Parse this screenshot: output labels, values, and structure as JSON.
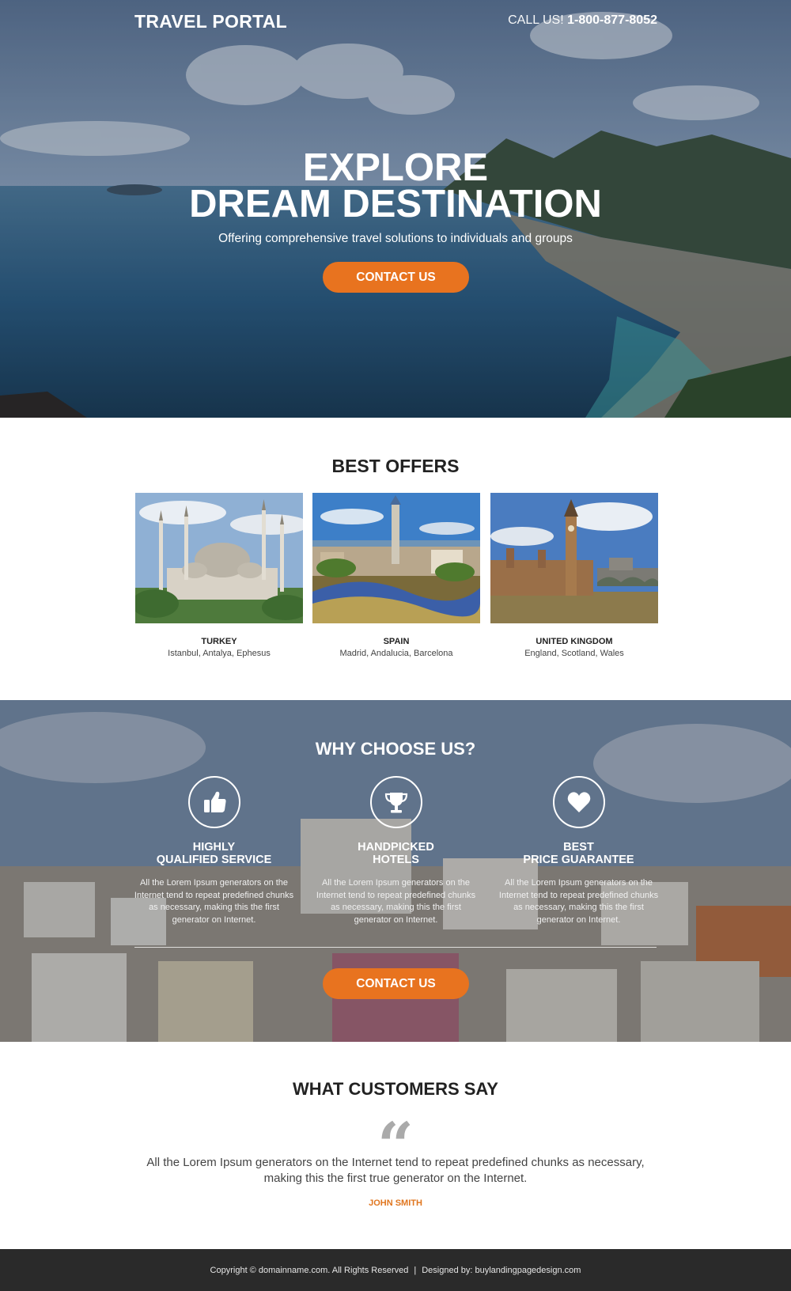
{
  "header": {
    "brand": "TRAVEL PORTAL",
    "call_label": "CALL US!",
    "phone": "1-800-877-8052"
  },
  "hero": {
    "title_line1": "EXPLORE",
    "title_line2": "DREAM DESTINATION",
    "subtitle": "Offering comprehensive travel solutions to individuals and groups",
    "cta_label": "CONTACT US"
  },
  "offers": {
    "title": "BEST OFFERS",
    "items": [
      {
        "name": "TURKEY",
        "cities": "Istanbul, Antalya, Ephesus"
      },
      {
        "name": "SPAIN",
        "cities": "Madrid, Andalucia, Barcelona"
      },
      {
        "name": "UNITED KINGDOM",
        "cities": "England, Scotland, Wales"
      }
    ]
  },
  "why": {
    "title": "WHY CHOOSE US?",
    "features": [
      {
        "icon": "thumbs-up-icon",
        "title_line1": "HIGHLY",
        "title_line2": "QUALIFIED SERVICE",
        "text": "All the Lorem Ipsum generators on the Internet tend to repeat predefined chunks as necessary, making this the first generator on Internet."
      },
      {
        "icon": "trophy-icon",
        "title_line1": "HANDPICKED",
        "title_line2": "HOTELS",
        "text": "All the Lorem Ipsum generators on the Internet tend to repeat predefined chunks as necessary, making this the first generator on Internet."
      },
      {
        "icon": "heart-icon",
        "title_line1": "BEST",
        "title_line2": "PRICE GUARANTEE",
        "text": "All the Lorem Ipsum generators on the Internet tend to repeat predefined chunks as necessary, making this the first generator on Internet."
      }
    ],
    "cta_label": "CONTACT US"
  },
  "testimonial": {
    "title": "WHAT CUSTOMERS SAY",
    "quote": "All the Lorem Ipsum generators on the Internet tend to repeat predefined chunks as necessary, making this the first true generator on the Internet.",
    "author": "JOHN SMITH"
  },
  "footer": {
    "copyright": "Copyright © domainname.com. All Rights Reserved",
    "separator": "|",
    "designed_by": "Designed by: buylandingpagedesign.com"
  },
  "colors": {
    "accent": "#e8731f",
    "footer_bg": "#2a2a2a",
    "author": "#e0761f"
  }
}
